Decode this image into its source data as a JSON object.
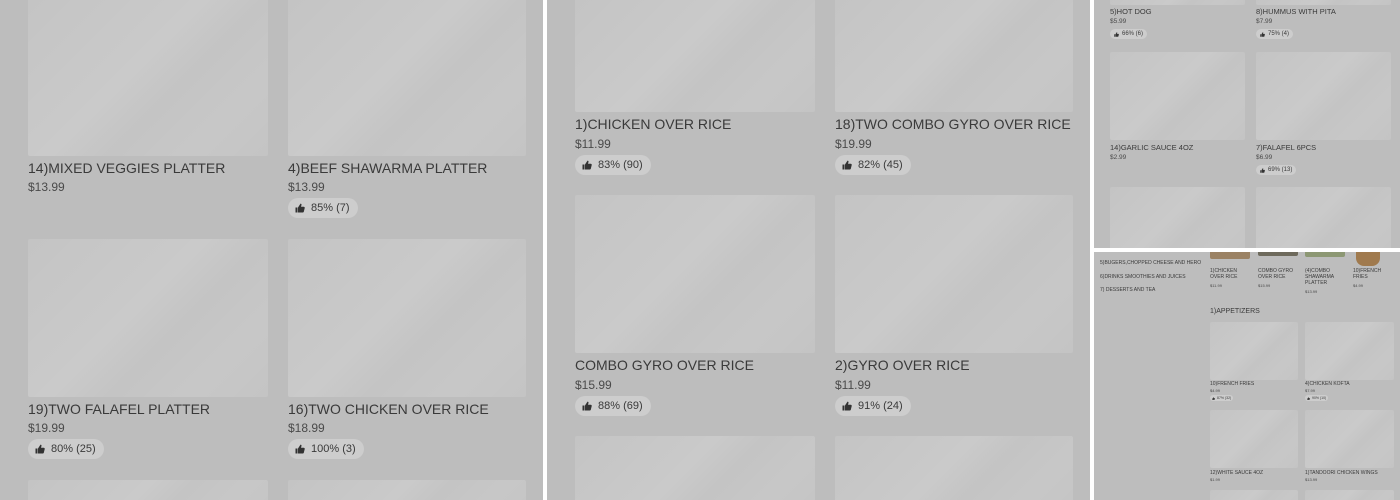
{
  "icon_names": {
    "rating": "thumbs-up-icon"
  },
  "colors": {
    "background": "#bdbdbd",
    "placeholder": "#c4c4c4",
    "pill": "#cdcdcd",
    "text": "#3a3a3a"
  },
  "panel_a": {
    "items": [
      {
        "name": "14)MIXED VEGGIES PLATTER",
        "price": "$13.99",
        "rating": ""
      },
      {
        "name": "4)BEEF SHAWARMA PLATTER",
        "price": "$13.99",
        "rating": "85% (7)"
      },
      {
        "name": "19)TWO FALAFEL PLATTER",
        "price": "$19.99",
        "rating": "80% (25)"
      },
      {
        "name": "16)TWO CHICKEN OVER RICE",
        "price": "$18.99",
        "rating": "100% (3)"
      }
    ]
  },
  "panel_b": {
    "items": [
      {
        "name": "1)CHICKEN OVER RICE",
        "price": "$11.99",
        "rating": "83% (90)"
      },
      {
        "name": "18)TWO COMBO GYRO OVER RICE",
        "price": "$19.99",
        "rating": "82% (45)"
      },
      {
        "name": "COMBO GYRO OVER RICE",
        "price": "$15.99",
        "rating": "88% (69)"
      },
      {
        "name": "2)GYRO OVER RICE",
        "price": "$11.99",
        "rating": "91% (24)"
      }
    ]
  },
  "panel_c": {
    "items": [
      {
        "name": "5)HOT DOG",
        "price": "$5.99",
        "rating": "66% (6)"
      },
      {
        "name": "8)HUMMUS WITH PITA",
        "price": "$7.99",
        "rating": "75% (4)"
      },
      {
        "name": "14)GARLIC SAUCE 4OZ",
        "price": "$2.99",
        "rating": ""
      },
      {
        "name": "7)FALAFEL  6PCS",
        "price": "$6.99",
        "rating": "69% (13)"
      }
    ]
  },
  "panel_d": {
    "categories": [
      "5)BUGERS,CHOPPED CHEESE AND HERO",
      "6)DRINKS SMOOTHIES AND JUICES",
      "7) DESSERTS AND TEA"
    ],
    "featured": [
      {
        "name": "1)CHICKEN OVER RICE",
        "price": "$11.99"
      },
      {
        "name": "COMBO GYRO OVER RICE",
        "price": "$15.99"
      },
      {
        "name": "(4)COMBO SHAWARMA PLATTER",
        "price": "$13.99"
      },
      {
        "name": "10)FRENCH FRIES",
        "price": "$4.99"
      }
    ],
    "section_title": "1)APPETIZERS",
    "items": [
      {
        "name": "10)FRENCH FRIES",
        "price": "$4.99",
        "rating": "87% (32)"
      },
      {
        "name": "4)CHICKEN KOFTA",
        "price": "$7.99",
        "rating": "90% (10)"
      },
      {
        "name": "12)WHITE SAUCE 4OZ",
        "price": "$1.99",
        "rating": ""
      },
      {
        "name": "1)TANDOORI CHICKEN WINGS",
        "price": "$13.99",
        "rating": ""
      }
    ]
  }
}
